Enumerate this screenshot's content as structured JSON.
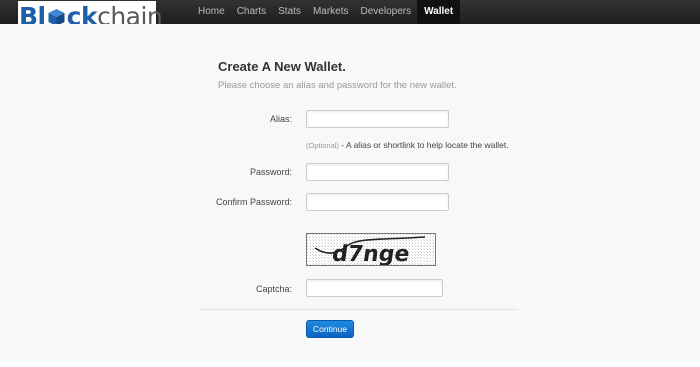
{
  "brand": {
    "logo_part1": "Bl",
    "logo_part2": "ck",
    "logo_part3": "chain",
    "colors": {
      "blue": "#1e5fa8",
      "gray": "#5a5a5a"
    }
  },
  "nav": {
    "items": [
      {
        "label": "Home"
      },
      {
        "label": "Charts"
      },
      {
        "label": "Stats"
      },
      {
        "label": "Markets"
      },
      {
        "label": "Developers"
      },
      {
        "label": "Wallet",
        "active": true
      }
    ]
  },
  "form": {
    "title": "Create A New Wallet.",
    "subtitle": "Please choose an alias and password for the new wallet.",
    "alias_label": "Alias:",
    "alias_value": "",
    "alias_hint_optional": "(Optional)",
    "alias_hint_text": " - A alias or shortlink to help locate the wallet.",
    "password_label": "Password:",
    "password_value": "",
    "confirm_label": "Confirm Password:",
    "confirm_value": "",
    "captcha_text": "d7nge",
    "captcha_label": "Captcha:",
    "captcha_value": "",
    "continue_label": "Continue"
  },
  "colors": {
    "topbar": "#262626",
    "button": "#0b63c4",
    "background": "#f8f8f8"
  }
}
